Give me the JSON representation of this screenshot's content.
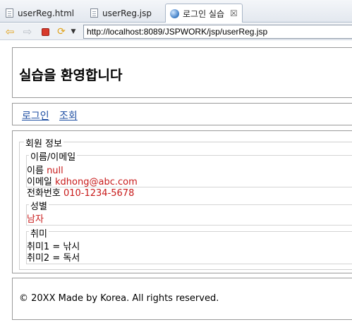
{
  "tabs": [
    {
      "label": "userReg.html",
      "icon": "file-icon",
      "active": false
    },
    {
      "label": "userReg.jsp",
      "icon": "file-icon",
      "active": false
    },
    {
      "label": "로그인 실습",
      "icon": "globe-icon",
      "active": true,
      "close": "☒"
    }
  ],
  "toolbar": {
    "url": "http://localhost:8089/JSPWORK/jsp/userReg.jsp"
  },
  "page": {
    "title": "실습을 환영합니다",
    "nav": [
      "로그인",
      "조회"
    ],
    "user_info": {
      "legend": "회원 정보",
      "name_email": {
        "legend": "이름/이메일",
        "name_label": "이름",
        "name_value": "null",
        "email_label": "이메일",
        "email_value": "kdhong@abc.com",
        "phone_label": "전화번호",
        "phone_value": "010-1234-5678"
      },
      "gender": {
        "legend": "성별",
        "value": "남자"
      },
      "hobby": {
        "legend": "취미",
        "items": [
          "취미1 = 낚시",
          "취미2 = 독서"
        ]
      }
    },
    "footer": "© 20XX Made by Korea. All rights reserved."
  },
  "colors": {
    "value_red": "#c81a1a",
    "link_blue": "#1f4fa3"
  }
}
